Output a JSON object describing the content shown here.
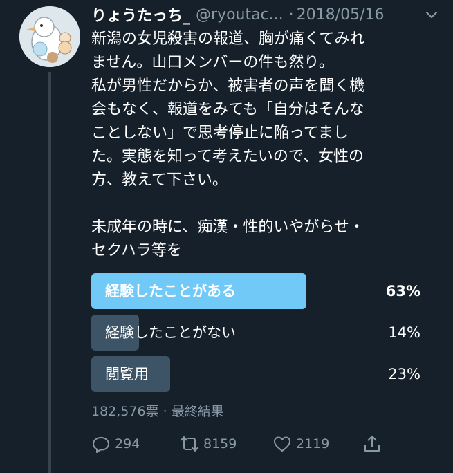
{
  "tweet": {
    "display_name": "りょうたっち_",
    "handle": "@ryoutac...",
    "separator": "·",
    "date": "2018/05/16",
    "text_lines": [
      "新潟の女児殺害の報道、胸が痛くてみれ",
      "ません。山口メンバーの件も然り。",
      "私が男性だからか、被害者の声を聞く機",
      "会もなく、報道をみても「自分はそんな",
      "ことしない」で思考停止に陥ってまし",
      "た。実態を知って考えたいので、女性の",
      "方、教えて下さい。",
      "",
      "未成年の時に、痴漢・性的いやがらせ・",
      "セクハラ等を"
    ]
  },
  "poll": {
    "options": [
      {
        "label": "経験したことがある",
        "percent": "63%",
        "share": 0.63,
        "winner": true
      },
      {
        "label": "経験したことがない",
        "percent": "14%",
        "share": 0.14,
        "winner": false
      },
      {
        "label": "閲覧用",
        "percent": "23%",
        "share": 0.23,
        "winner": false
      }
    ],
    "meta": "182,576票 · 最終結果",
    "winner_color": "#71c9f8",
    "bar_color": "#3d5466"
  },
  "actions": {
    "reply_count": "294",
    "retweet_count": "8159",
    "like_count": "2119",
    "icons": [
      "reply-icon",
      "retweet-icon",
      "like-icon",
      "share-icon"
    ]
  },
  "colors": {
    "background": "#15202b",
    "secondary_text": "#8899a6"
  }
}
